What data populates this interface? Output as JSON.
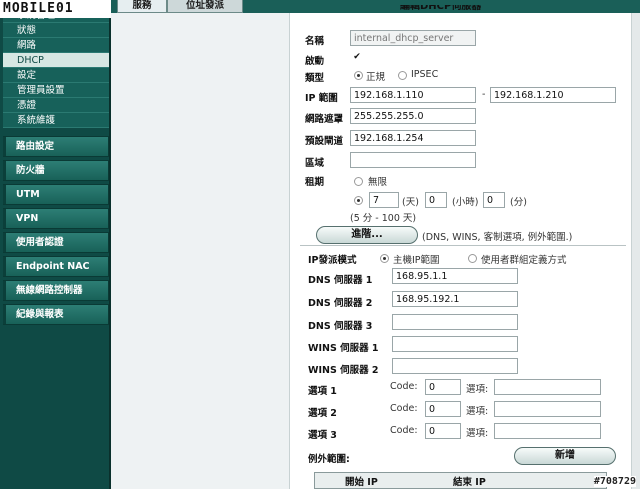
{
  "logo": "MOBILE01",
  "sidebar": {
    "section_partial": "系統管理",
    "sub_items": [
      {
        "label": "狀態"
      },
      {
        "label": "網路"
      },
      {
        "label": "DHCP"
      },
      {
        "label": "設定"
      },
      {
        "label": "管理員設置"
      },
      {
        "label": "憑證"
      },
      {
        "label": "系統維護"
      }
    ],
    "main_items": [
      {
        "label": "路由設定"
      },
      {
        "label": "防火牆"
      },
      {
        "label": "UTM"
      },
      {
        "label": "VPN"
      },
      {
        "label": "使用者認證"
      },
      {
        "label": "Endpoint NAC"
      },
      {
        "label": "無線網路控制器"
      },
      {
        "label": "紀錄與報表"
      }
    ]
  },
  "tabs": {
    "service": "服務",
    "address": "位址發派"
  },
  "panel": {
    "title": "編輯DHCP伺服器"
  },
  "form": {
    "name_label": "名稱",
    "name_value": "internal_dhcp_server",
    "enable_label": "啟動",
    "enable_check": "✔",
    "type_label": "類型",
    "type_normal": "正規",
    "type_ipsec": "IPSEC",
    "ip_range_label": "IP 範圍",
    "ip_start": "192.168.1.110",
    "ip_dash": "-",
    "ip_end": "192.168.1.210",
    "netmask_label": "網路遮罩",
    "netmask_value": "255.255.255.0",
    "gateway_label": "預設閘道",
    "gateway_value": "192.168.1.254",
    "domain_label": "區域",
    "domain_value": "",
    "lease_label": "租期",
    "lease_unlimited": "無限",
    "lease_days": "7",
    "lease_days_unit": "(天)",
    "lease_hours": "0",
    "lease_hours_unit": "(小時)",
    "lease_minutes": "0",
    "lease_minutes_unit": "(分)",
    "lease_hint": "(5 分 - 100 天)",
    "advanced_button": "進階...",
    "advanced_hint": "(DNS, WINS, 客制選項, 例外範圍.)"
  },
  "advanced": {
    "ip_assign_label": "IP發派模式",
    "ip_assign_host": "主機IP範圍",
    "ip_assign_user": "使用者群組定義方式",
    "dns1_label": "DNS 伺服器 1",
    "dns1_value": "168.95.1.1",
    "dns2_label": "DNS 伺服器 2",
    "dns2_value": "168.95.192.1",
    "dns3_label": "DNS 伺服器 3",
    "dns3_value": "",
    "wins1_label": "WINS 伺服器 1",
    "wins1_value": "",
    "wins2_label": "WINS 伺服器 2",
    "wins2_value": "",
    "options": [
      {
        "label": "選項 1",
        "code_label": "Code:",
        "code_value": "0",
        "option_label": "選項:",
        "option_value": ""
      },
      {
        "label": "選項 2",
        "code_label": "Code:",
        "code_value": "0",
        "option_label": "選項:",
        "option_value": ""
      },
      {
        "label": "選項 3",
        "code_label": "Code:",
        "code_value": "0",
        "option_label": "選項:",
        "option_value": ""
      }
    ],
    "exclusion_label": "例外範圍:",
    "add_button": "新增",
    "table_headers": {
      "start": "開始 IP",
      "end": "結束 IP"
    }
  },
  "watermark": "#708729"
}
